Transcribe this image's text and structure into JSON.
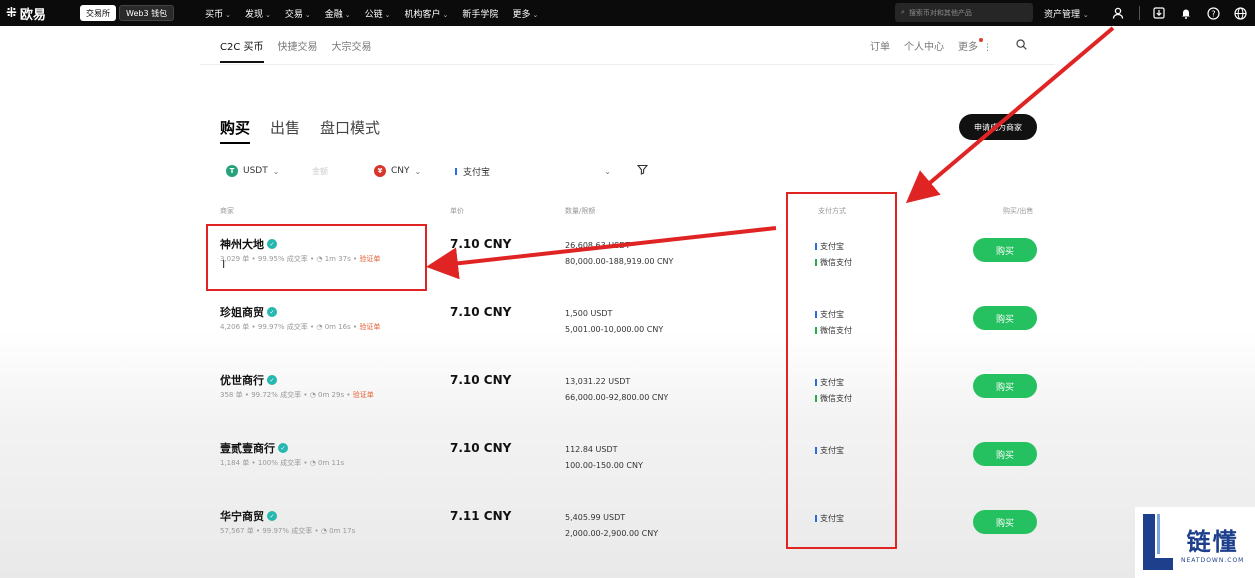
{
  "topbar": {
    "logo": "欧易",
    "mode_tabs": [
      "交易所",
      "Web3 钱包"
    ],
    "nav": [
      {
        "label": "买币",
        "caret": true
      },
      {
        "label": "发现",
        "caret": true
      },
      {
        "label": "交易",
        "caret": true
      },
      {
        "label": "金融",
        "caret": true
      },
      {
        "label": "公链",
        "caret": true
      },
      {
        "label": "机构客户",
        "caret": true
      },
      {
        "label": "新手学院",
        "caret": false
      },
      {
        "label": "更多",
        "caret": true
      }
    ],
    "search_placeholder": "搜索币对和其他产品",
    "asset_menu": "资产管理"
  },
  "subnav": {
    "tabs": [
      "C2C 买币",
      "快捷交易",
      "大宗交易"
    ],
    "right": [
      "订单",
      "个人中心",
      "更多"
    ]
  },
  "main_tabs": [
    "购买",
    "出售",
    "盘口模式"
  ],
  "apply_button": "申请成为商家",
  "filters": {
    "coin": "USDT",
    "amount_placeholder": "金额",
    "fiat": "CNY",
    "payment": "支付宝"
  },
  "table": {
    "headers": [
      "商家",
      "单价",
      "数量/限额",
      "支付方式",
      "购买/出售"
    ],
    "rows": [
      {
        "merchant": "神州大地",
        "orders": "3,029 单",
        "rate": "99.95% 成交率",
        "time": "1m 37s",
        "badge": "验证单",
        "price": "7.10 CNY",
        "qty": "26,608.63 USDT",
        "limit": "80,000.00-188,919.00 CNY",
        "payments": [
          "支付宝",
          "微信支付"
        ],
        "button": "购买"
      },
      {
        "merchant": "珍姐商贸",
        "orders": "4,206 单",
        "rate": "99.97% 成交率",
        "time": "0m 16s",
        "badge": "验证单",
        "price": "7.10 CNY",
        "qty": "1,500 USDT",
        "limit": "5,001.00-10,000.00 CNY",
        "payments": [
          "支付宝",
          "微信支付"
        ],
        "button": "购买"
      },
      {
        "merchant": "优世商行",
        "orders": "358 单",
        "rate": "99.72% 成交率",
        "time": "0m 29s",
        "badge": "验证单",
        "price": "7.10 CNY",
        "qty": "13,031.22 USDT",
        "limit": "66,000.00-92,800.00 CNY",
        "payments": [
          "支付宝",
          "微信支付"
        ],
        "button": "购买"
      },
      {
        "merchant": "壹贰壹商行",
        "orders": "1,184 单",
        "rate": "100% 成交率",
        "time": "0m 11s",
        "badge": "",
        "price": "7.10 CNY",
        "qty": "112.84 USDT",
        "limit": "100.00-150.00 CNY",
        "payments": [
          "支付宝"
        ],
        "button": "购买"
      },
      {
        "merchant": "华宁商贸",
        "orders": "57,567 单",
        "rate": "99.97% 成交率",
        "time": "0m 17s",
        "badge": "",
        "price": "7.11 CNY",
        "qty": "5,405.99 USDT",
        "limit": "2,000.00-2,900.00 CNY",
        "payments": [
          "支付宝"
        ],
        "button": "购买"
      }
    ]
  },
  "watermark": {
    "cn": "链懂",
    "en": "NEATDOWN.COM"
  },
  "colors": {
    "buy_green": "#25c160",
    "annotation_red": "#e02424",
    "verified_teal": "#27b7b1",
    "badge_orange": "#e65c2f"
  }
}
